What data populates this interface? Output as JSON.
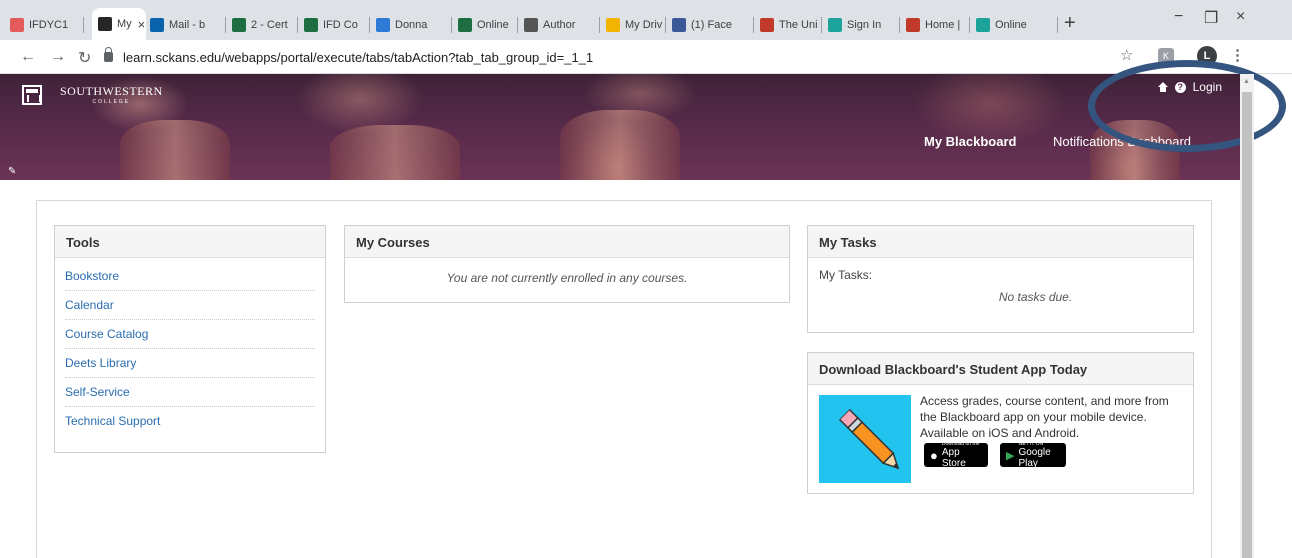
{
  "browser": {
    "tabs": [
      {
        "label": "IFDYC1",
        "icon": "ifd-icon",
        "color": "#e45b5b"
      },
      {
        "label": "My",
        "icon": "blackboard-icon",
        "color": "#262626",
        "active": true
      },
      {
        "label": "Mail - b",
        "icon": "outlook-icon",
        "color": "#0a64ad"
      },
      {
        "label": "2 - Cert",
        "icon": "excel-icon",
        "color": "#1d6f42"
      },
      {
        "label": "IFD Co",
        "icon": "excel-icon",
        "color": "#1d6f42"
      },
      {
        "label": "Donna",
        "icon": "cloud-icon",
        "color": "#2d7bd6"
      },
      {
        "label": "Online",
        "icon": "doc-icon",
        "color": "#1d6f42"
      },
      {
        "label": "Author",
        "icon": "globe-icon",
        "color": "#555555"
      },
      {
        "label": "My Driv",
        "icon": "drive-icon",
        "color": "#f2b400"
      },
      {
        "label": "(1) Face",
        "icon": "facebook-icon",
        "color": "#3b5998"
      },
      {
        "label": "The Uni",
        "icon": "flag-icon",
        "color": "#c0392b"
      },
      {
        "label": "Sign In",
        "icon": "signin-icon",
        "color": "#1ba39c"
      },
      {
        "label": "Home |",
        "icon": "flag-icon",
        "color": "#c0392b"
      },
      {
        "label": "Online",
        "icon": "teams-icon",
        "color": "#1ba39c"
      }
    ],
    "url": "learn.sckans.edu/webapps/portal/execute/tabs/tabAction?tab_tab_group_id=_1_1",
    "avatar_initial": "L",
    "ext_initial": "K"
  },
  "banner": {
    "logo_name": "SOUTHWESTERN",
    "logo_sub": "COLLEGE",
    "login": "Login",
    "nav_tabs": [
      "My Blackboard",
      "Notifications Dashboard"
    ]
  },
  "tools": {
    "title": "Tools",
    "links": [
      "Bookstore",
      "Calendar",
      "Course Catalog",
      "Deets Library",
      "Self-Service",
      "Technical Support"
    ]
  },
  "courses": {
    "title": "My Courses",
    "empty_message": "You are not currently enrolled in any courses."
  },
  "tasks": {
    "title": "My Tasks",
    "label": "My Tasks:",
    "empty_message": "No tasks due."
  },
  "app_promo": {
    "title": "Download Blackboard's Student App Today",
    "text": "Access grades, course content, and more from the Blackboard app on your mobile device. Available on iOS and Android.",
    "app_store_small": "Download on the",
    "app_store": "App Store",
    "google_small": "GET IT ON",
    "google": "Google Play"
  }
}
